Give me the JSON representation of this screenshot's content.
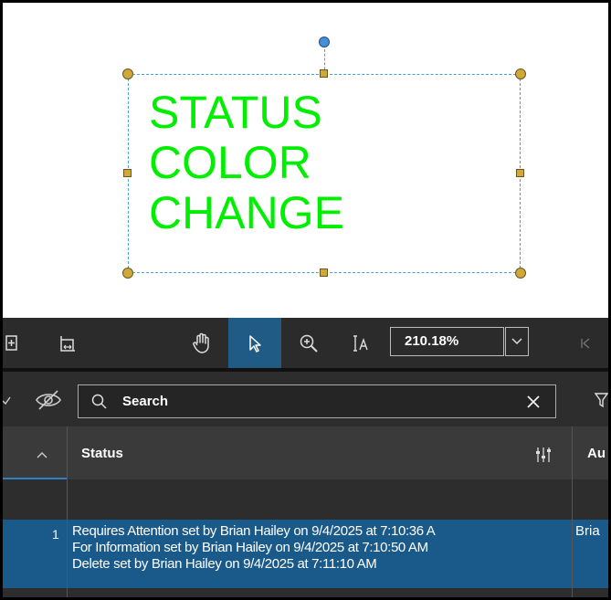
{
  "canvas": {
    "stamp_text": "STATUS\nCOLOR\nCHANGE",
    "stamp_color": "#00ee00",
    "selection_color": "#4a9fd6",
    "handle_color": "#d0a83a",
    "rotation_handle_color": "#4a8fd6"
  },
  "toolbar": {
    "tools": [
      "page-extract-icon",
      "page-resize-icon",
      "pan-hand-icon",
      "select-arrow-icon",
      "zoom-in-icon",
      "text-select-icon"
    ],
    "active_tool": "select-arrow-icon",
    "zoom_value": "210.18%",
    "active_color": "#1f5b85"
  },
  "panel": {
    "search_placeholder": "Search",
    "columns": {
      "status": "Status",
      "author": "Au"
    },
    "rows": [
      {
        "number": "1",
        "status_lines": [
          "Requires Attention set by Brian Hailey on 9/4/2025 at 7:10:36 A",
          "For Information set by Brian Hailey on 9/4/2025 at 7:10:50 AM",
          "Delete set by Brian Hailey on 9/4/2025 at 7:11:10 AM"
        ],
        "author": "Bria"
      }
    ],
    "selected_row_color": "#1a5a8a"
  }
}
